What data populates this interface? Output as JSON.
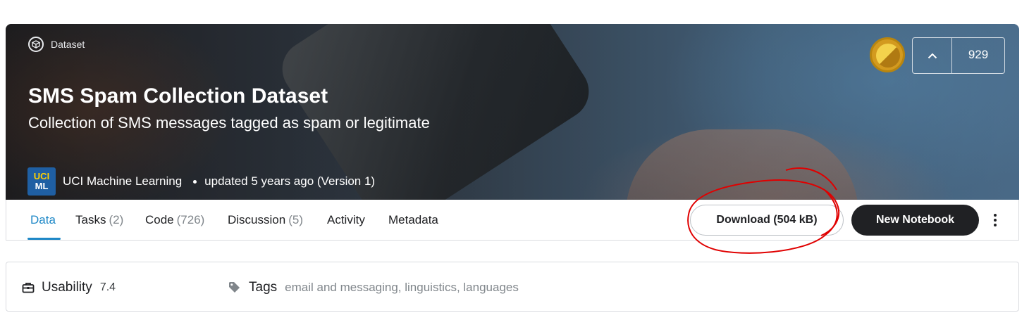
{
  "header": {
    "type_label": "Dataset",
    "title": "SMS Spam Collection Dataset",
    "subtitle": "Collection of SMS messages tagged as spam or legitimate",
    "owner": {
      "avatar_line1": "UCI",
      "avatar_line2": "ML",
      "name": "UCI Machine Learning"
    },
    "updated": "updated 5 years ago (Version 1)",
    "medal_icon": "gold-medal-icon",
    "upvote_count": "929"
  },
  "tabs": [
    {
      "label": "Data",
      "count": ""
    },
    {
      "label": "Tasks",
      "count": "(2)"
    },
    {
      "label": "Code",
      "count": "(726)"
    },
    {
      "label": "Discussion",
      "count": "(5)"
    },
    {
      "label": "Activity",
      "count": ""
    },
    {
      "label": "Metadata",
      "count": ""
    }
  ],
  "actions": {
    "download_label": "Download (504 kB)",
    "new_notebook_label": "New Notebook"
  },
  "info": {
    "usability_label": "Usability",
    "usability_score": "7.4",
    "tags_label": "Tags",
    "tags": [
      "email and messaging",
      "linguistics",
      "languages"
    ]
  },
  "colors": {
    "accent": "#1e88c7",
    "dark_button": "#202124",
    "annotation": "#e00000",
    "medal": "#d39a1f"
  }
}
